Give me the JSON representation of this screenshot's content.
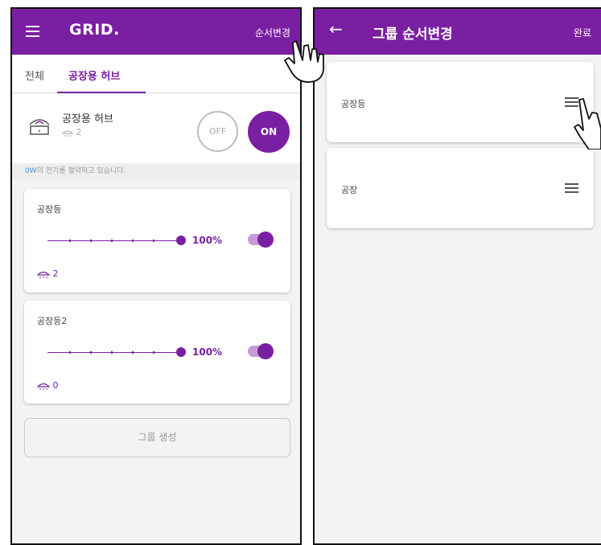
{
  "left_screen": {
    "brand": "GRID.",
    "reorder_action": "순서변경",
    "tabs": [
      {
        "label": "전체",
        "active": false
      },
      {
        "label": "공장용 허브",
        "active": true
      }
    ],
    "hub": {
      "name": "공장용 허브",
      "device_count": "2",
      "off_label": "OFF",
      "on_label": "ON"
    },
    "saving": {
      "watts": "0W",
      "text": "의 전기를 절약하고 있습니다."
    },
    "groups": [
      {
        "name": "공장등",
        "brightness": "100%",
        "brightness_value": 100,
        "switch_on": true,
        "count": "2"
      },
      {
        "name": "공장등2",
        "brightness": "100%",
        "brightness_value": 100,
        "switch_on": true,
        "count": "0"
      }
    ],
    "create_group": "그룹 생성"
  },
  "right_screen": {
    "title": "그룹 순서변경",
    "done_action": "완료",
    "groups": [
      {
        "name": "공장등"
      },
      {
        "name": "공장"
      }
    ]
  },
  "colors": {
    "accent": "#7b1fa2",
    "accent_light": "#c79ad8",
    "info_blue": "#3f8fd6"
  },
  "icons": [
    "menu-icon",
    "back-icon",
    "hub-icon",
    "lamp-icon",
    "drag-handle-icon",
    "hand-pointer-icon"
  ]
}
